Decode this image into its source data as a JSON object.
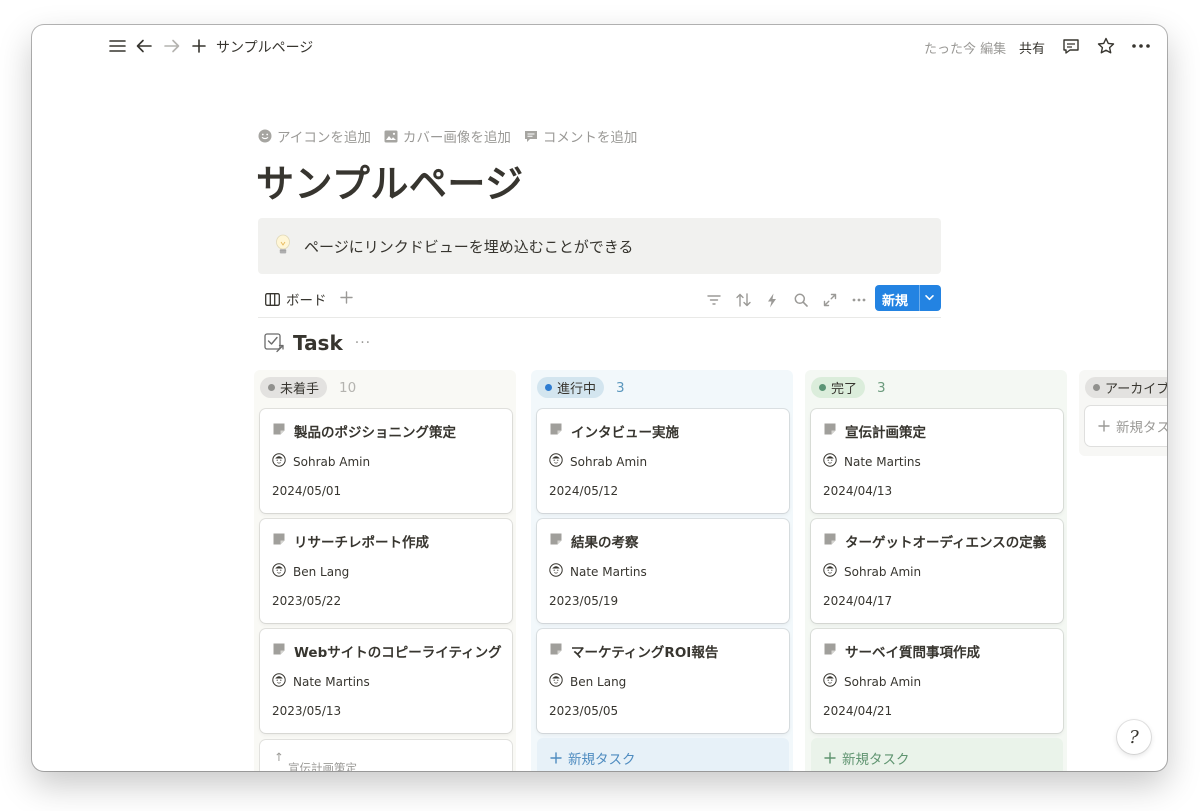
{
  "topbar": {
    "page_title": "サンプルページ",
    "edited": "たった今 編集",
    "share": "共有"
  },
  "page": {
    "actions": {
      "add_icon": "アイコンを追加",
      "add_cover": "カバー画像を追加",
      "add_comment": "コメントを追加"
    },
    "title": "サンプルページ",
    "callout": {
      "icon": "lightbulb-icon",
      "text": "ページにリンクドビューを埋め込むことができる"
    }
  },
  "view": {
    "tab_label": "ボード",
    "new_label": "新規"
  },
  "database": {
    "title": "Task",
    "more": "···"
  },
  "columns": [
    {
      "label": "未着手",
      "count": "10",
      "dot_color": "#91918e",
      "pill_bg": "#e3e2e0",
      "col_bg": "#f9f9f5",
      "count_color": "#b4b3af",
      "cards": [
        {
          "title": "製品のポジショニング策定",
          "person": "Sohrab Amin",
          "date": "2024/05/01"
        },
        {
          "title": "リサーチレポート作成",
          "person": "Ben Lang",
          "date": "2023/05/22"
        },
        {
          "title": "Webサイトのコピーライティング",
          "person": "Nate Martins",
          "date": "2023/05/13"
        }
      ],
      "partial_card": "宣伝計画策定"
    },
    {
      "label": "進行中",
      "count": "3",
      "dot_color": "#2e7cd1",
      "pill_bg": "#d3e5ef",
      "col_bg": "#f2f8fb",
      "count_color": "#5b97bd",
      "cards": [
        {
          "title": "インタビュー実施",
          "person": "Sohrab Amin",
          "date": "2024/05/12"
        },
        {
          "title": "結果の考察",
          "person": "Nate Martins",
          "date": "2023/05/19"
        },
        {
          "title": "マーケティングROI報告",
          "person": "Ben Lang",
          "date": "2023/05/05"
        }
      ],
      "add_task": "新規タスク",
      "add_bg": "#e7f1f8",
      "add_color": "#4f8cc0"
    },
    {
      "label": "完了",
      "count": "3",
      "dot_color": "#5a9474",
      "pill_bg": "#dbeddb",
      "col_bg": "#f4f8f3",
      "count_color": "#6c9b7d",
      "cards": [
        {
          "title": "宣伝計画策定",
          "person": "Nate Martins",
          "date": "2024/04/13"
        },
        {
          "title": "ターゲットオーディエンスの定義",
          "person": "Sohrab Amin",
          "date": "2024/04/17"
        },
        {
          "title": "サーベイ質問事項作成",
          "person": "Sohrab Amin",
          "date": "2024/04/21"
        }
      ],
      "add_task": "新規タスク",
      "add_bg": "#eaf3ea",
      "add_color": "#5f9470"
    },
    {
      "label": "アーカイブ",
      "dot_color": "#91918e",
      "pill_bg": "#e3e2e0",
      "col_bg": "#f7f7f5",
      "add_task": "新規タスク"
    }
  ],
  "help": "?"
}
